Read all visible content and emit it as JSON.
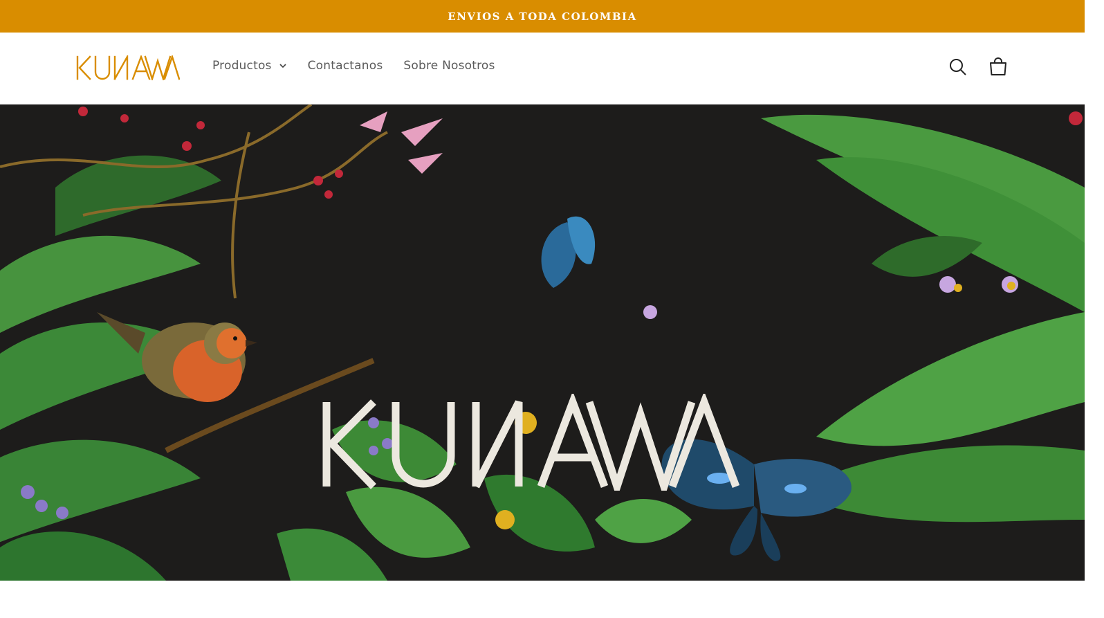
{
  "announcement": {
    "text": "ENVIOS A TODA COLOMBIA"
  },
  "header": {
    "logo_text": "KUNAWA",
    "nav": [
      {
        "label": "Productos",
        "has_dropdown": true
      },
      {
        "label": "Contactanos",
        "has_dropdown": false
      },
      {
        "label": "Sobre Nosotros",
        "has_dropdown": false
      }
    ],
    "icons": [
      "search-icon",
      "cart-icon"
    ]
  },
  "hero": {
    "logo_text": "KUNAWA"
  },
  "colors": {
    "announcement_bg": "#d98d00",
    "logo": "#d98d00",
    "hero_bg": "#1d1c1b",
    "hero_logo": "#ece8df"
  }
}
